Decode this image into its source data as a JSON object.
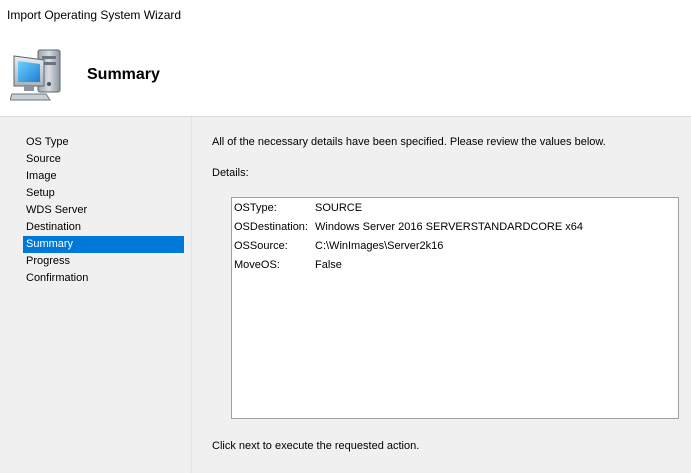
{
  "window": {
    "title": "Import Operating System Wizard"
  },
  "header": {
    "title": "Summary",
    "icon": "computer-icon"
  },
  "sidebar": {
    "steps": [
      {
        "label": "OS Type",
        "active": false
      },
      {
        "label": "Source",
        "active": false
      },
      {
        "label": "Image",
        "active": false
      },
      {
        "label": "Setup",
        "active": false
      },
      {
        "label": "WDS Server",
        "active": false
      },
      {
        "label": "Destination",
        "active": false
      },
      {
        "label": "Summary",
        "active": true
      },
      {
        "label": "Progress",
        "active": false
      },
      {
        "label": "Confirmation",
        "active": false
      }
    ]
  },
  "main": {
    "intro": "All of the necessary details have been specified.  Please review the values below.",
    "details_label": "Details:",
    "details": [
      {
        "key": "OSType:",
        "value": "SOURCE"
      },
      {
        "key": "OSDestination:",
        "value": "Windows Server 2016 SERVERSTANDARDCORE x64"
      },
      {
        "key": "OSSource:",
        "value": "C:\\WinImages\\Server2k16"
      },
      {
        "key": "MoveOS:",
        "value": "False"
      }
    ],
    "footer": "Click next to execute the requested action."
  },
  "colors": {
    "selection": "#0078d7",
    "panel_background": "#f0f0f0",
    "header_background": "#ffffff"
  }
}
